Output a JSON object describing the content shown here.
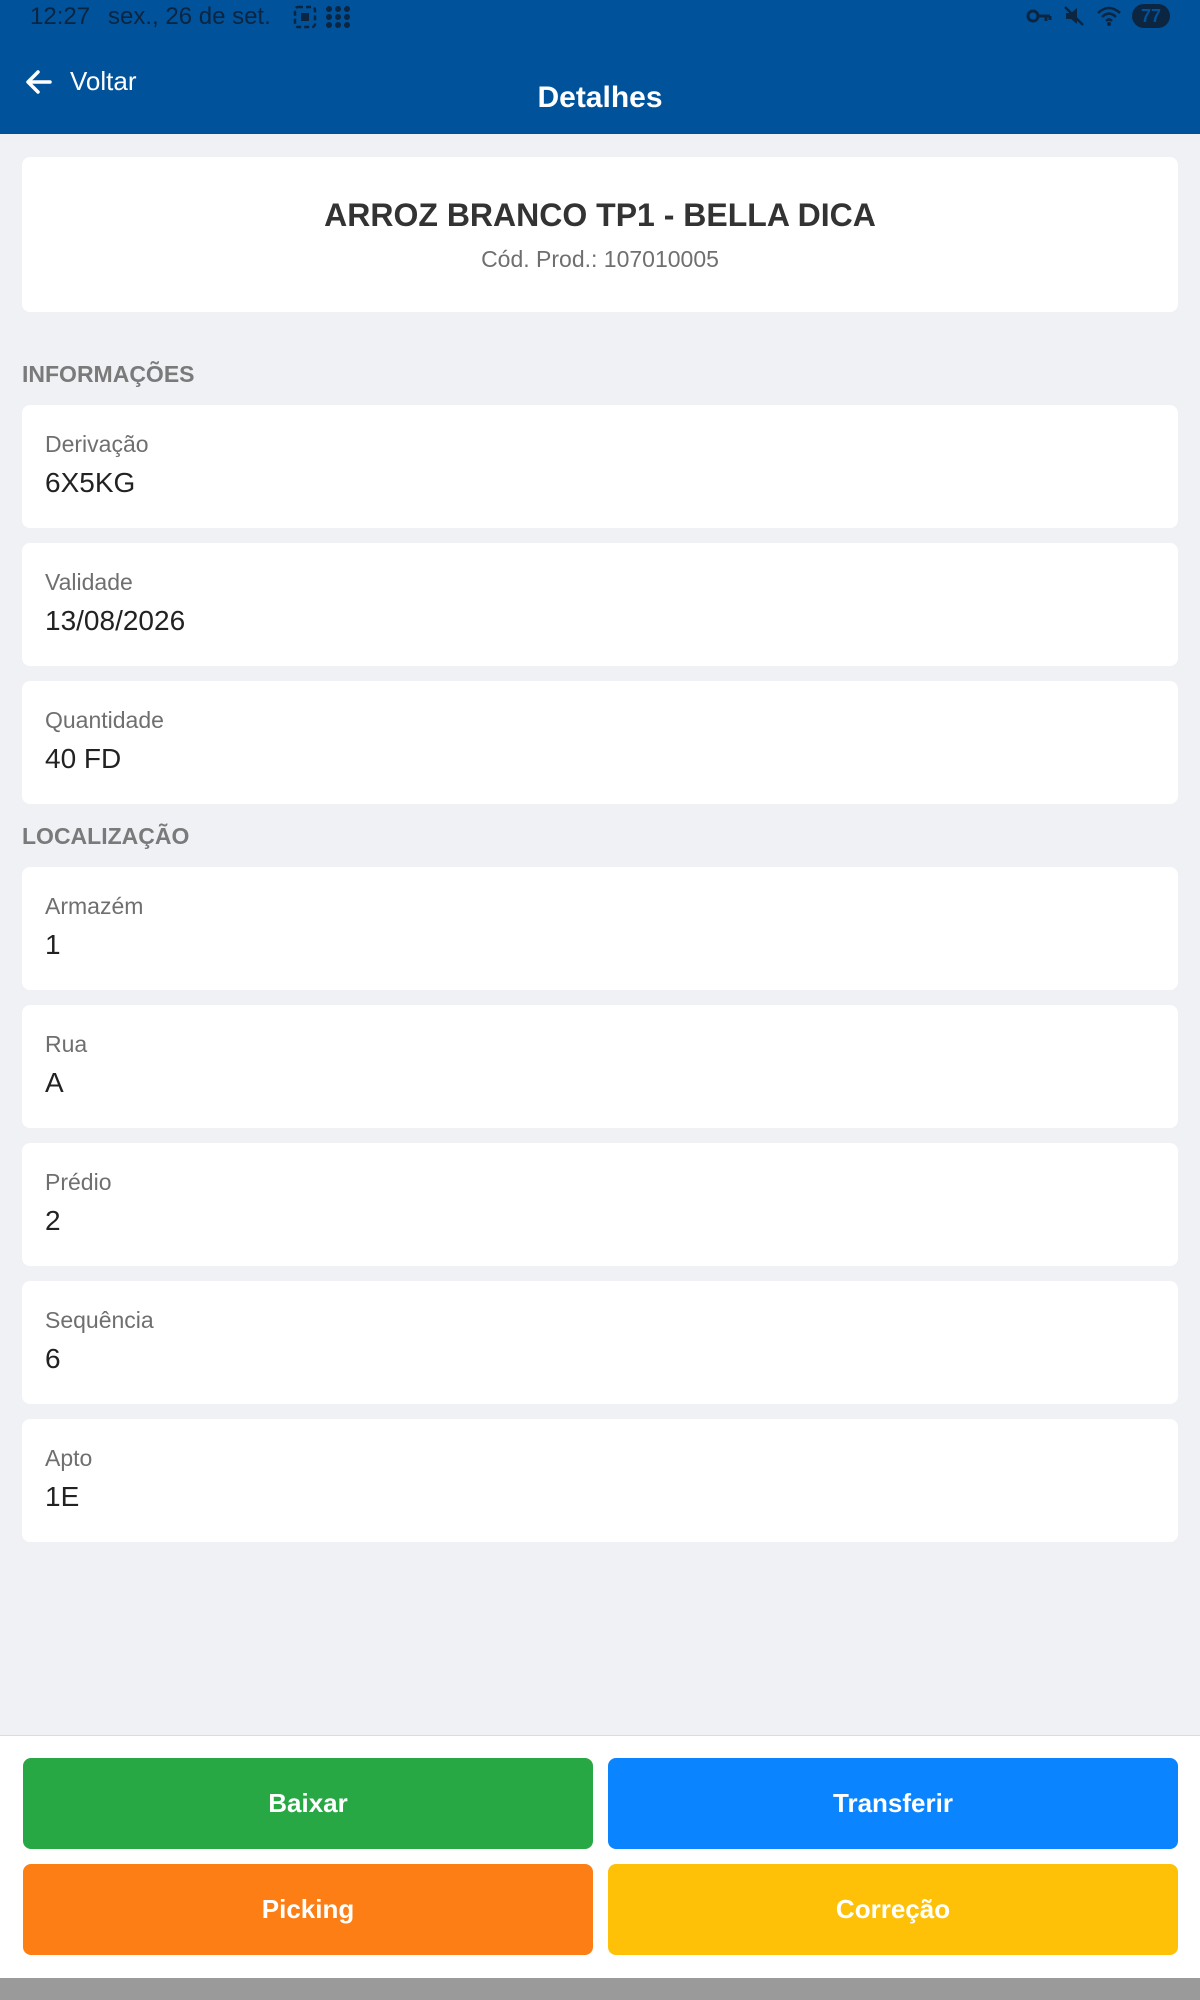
{
  "status_bar": {
    "time": "12:27",
    "date": "sex., 26 de set.",
    "battery": "77"
  },
  "header": {
    "back_label": "Voltar",
    "title": "Detalhes"
  },
  "product": {
    "name": "ARROZ BRANCO TP1 - BELLA DICA",
    "code": "Cód. Prod.: 107010005"
  },
  "sections": {
    "info_title": "INFORMAÇÕES",
    "location_title": "LOCALIZAÇÃO"
  },
  "info_fields": [
    {
      "label": "Derivação",
      "value": "6X5KG"
    },
    {
      "label": "Validade",
      "value": "13/08/2026"
    },
    {
      "label": "Quantidade",
      "value": "40 FD"
    }
  ],
  "location_fields": [
    {
      "label": "Armazém",
      "value": "1"
    },
    {
      "label": "Rua",
      "value": "A"
    },
    {
      "label": "Prédio",
      "value": "2"
    },
    {
      "label": "Sequência",
      "value": "6"
    },
    {
      "label": "Apto",
      "value": "1E"
    }
  ],
  "actions": {
    "baixar": "Baixar",
    "transferir": "Transferir",
    "picking": "Picking",
    "correcao": "Correção"
  },
  "colors": {
    "header": "#00529b",
    "baixar": "#28a745",
    "transferir": "#0a84ff",
    "picking": "#fd7e14",
    "correcao": "#ffc107"
  }
}
